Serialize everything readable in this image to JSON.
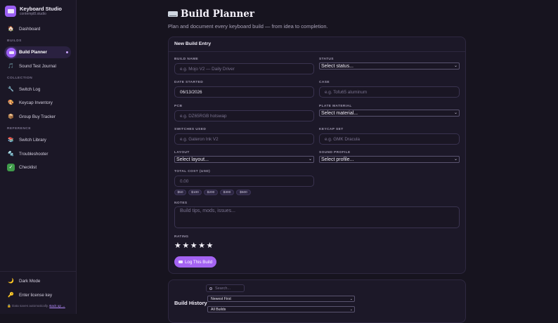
{
  "brand": {
    "title": "Keyboard Studio",
    "subtitle": "contempl8.studio"
  },
  "sidebar": {
    "top_item": {
      "label": "Dashboard",
      "icon": "home-icon"
    },
    "sections": [
      {
        "heading": "BUILDS",
        "items": [
          {
            "label": "Build Planner",
            "icon": "keyboard-icon",
            "active": true
          },
          {
            "label": "Sound Test Journal",
            "icon": "music-note-icon"
          }
        ]
      },
      {
        "heading": "COLLECTION",
        "items": [
          {
            "label": "Switch Log",
            "icon": "wrench-icon"
          },
          {
            "label": "Keycap Inventory",
            "icon": "palette-icon"
          },
          {
            "label": "Group Buy Tracker",
            "icon": "package-icon"
          }
        ]
      },
      {
        "heading": "REFERENCE",
        "items": [
          {
            "label": "Switch Library",
            "icon": "books-icon"
          },
          {
            "label": "Troubleshooter",
            "icon": "tools-icon"
          },
          {
            "label": "Checklist",
            "icon": "checkmark-icon"
          }
        ]
      }
    ],
    "bottom": {
      "dark_mode": "Dark Mode",
      "license": "Enter license key",
      "note": "Data saves automatically.",
      "note_link": "Back up →"
    }
  },
  "page": {
    "title": "Build Planner",
    "subtitle": "Plan and document every keyboard build — from idea to completion."
  },
  "form": {
    "title": "New Build Entry",
    "build_name": {
      "label": "BUILD NAME",
      "placeholder": "e.g. Mojo V2 — Daily Driver"
    },
    "status": {
      "label": "STATUS",
      "value": "Select status..."
    },
    "date_started": {
      "label": "DATE STARTED",
      "value": "06/13/2026"
    },
    "case": {
      "label": "CASE",
      "placeholder": "e.g. Tofu65 aluminum"
    },
    "pcb": {
      "label": "PCB",
      "placeholder": "e.g. DZ65RGB hotswap"
    },
    "plate": {
      "label": "PLATE MATERIAL",
      "value": "Select material..."
    },
    "switches": {
      "label": "SWITCHES USED",
      "placeholder": "e.g. Gateron Ink V2"
    },
    "keycaps": {
      "label": "KEYCAP SET",
      "placeholder": "e.g. GMK Dracula"
    },
    "layout": {
      "label": "LAYOUT",
      "value": "Select layout..."
    },
    "sound": {
      "label": "SOUND PROFILE",
      "value": "Select profile..."
    },
    "cost": {
      "label": "TOTAL COST (USD)",
      "placeholder": "0.00"
    },
    "cost_chips": [
      "$50",
      "$100",
      "$200",
      "$300",
      "$500"
    ],
    "notes": {
      "label": "NOTES",
      "placeholder": "Build tips, mods, issues..."
    },
    "rating": {
      "label": "RATING",
      "stars": 5,
      "glyph": "★"
    },
    "submit": "Log This Build"
  },
  "history": {
    "title": "Build History",
    "search_placeholder": "Search...",
    "sort": "Newest First",
    "filter": "All Builds"
  }
}
